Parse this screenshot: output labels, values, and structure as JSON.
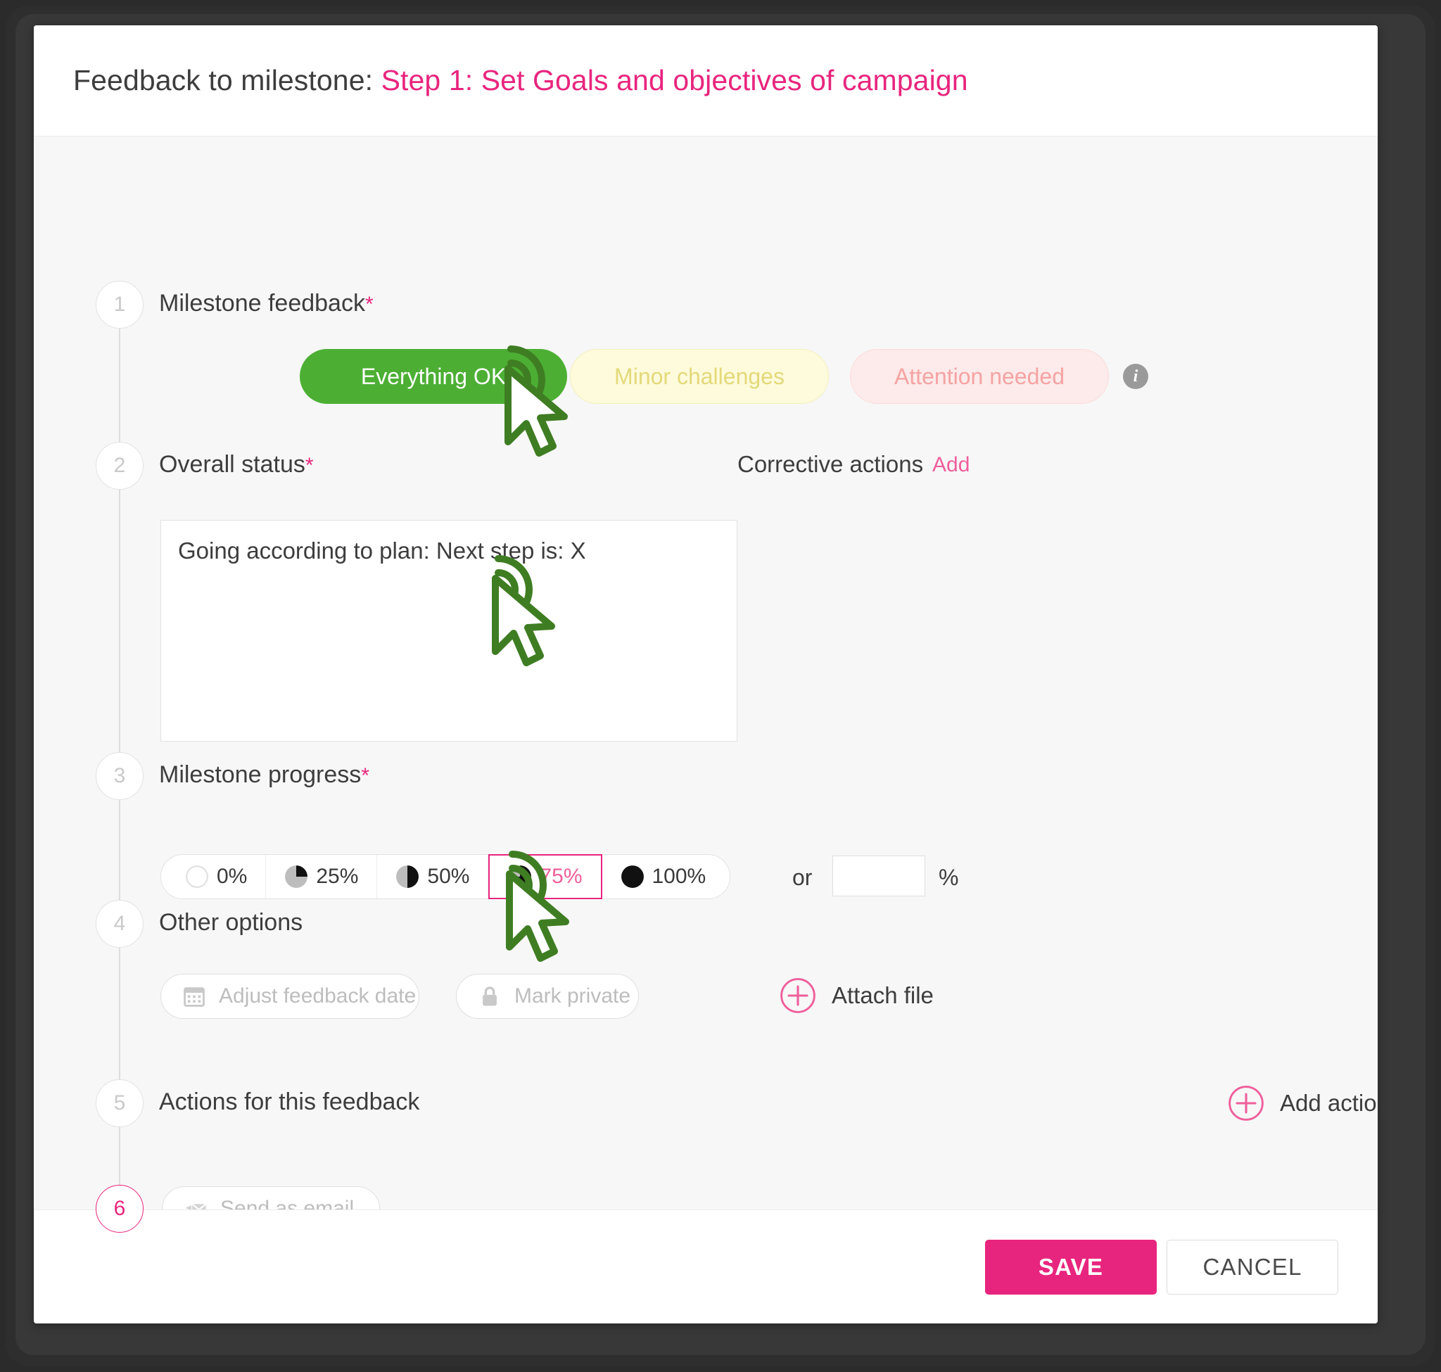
{
  "dialog": {
    "title_prefix": "Feedback to milestone:",
    "title_accent": "Step 1: Set Goals and objectives of campaign"
  },
  "steps": [
    {
      "number": "1",
      "label": "Milestone feedback",
      "required": "*"
    },
    {
      "number": "2",
      "label": "Overall status",
      "required": "*"
    },
    {
      "number": "3",
      "label": "Milestone progress",
      "required": "*"
    },
    {
      "number": "4",
      "label": "Other options",
      "required": ""
    },
    {
      "number": "5",
      "label": "Actions for this feedback",
      "required": ""
    },
    {
      "number": "6",
      "label": "",
      "required": ""
    }
  ],
  "feedback_options": {
    "everything_ok": "Everything OK",
    "minor_challenges": "Minor challenges",
    "attention_needed": "Attention needed",
    "info_glyph": "i",
    "selected": "Everything OK"
  },
  "overall_status": {
    "value": "Going according to plan: Next step is: X",
    "placeholder": ""
  },
  "corrective_actions": {
    "label": "Corrective actions",
    "add_label": "Add"
  },
  "milestone_progress": {
    "options": [
      {
        "label": "0%",
        "fill": 0
      },
      {
        "label": "25%",
        "fill": 25
      },
      {
        "label": "50%",
        "fill": 50
      },
      {
        "label": "75%",
        "fill": 75
      },
      {
        "label": "100%",
        "fill": 100
      }
    ],
    "selected": "75%",
    "or_label": "or",
    "custom_value": "",
    "percent_sign": "%"
  },
  "other_options": {
    "adjust_date": "Adjust feedback date",
    "mark_private": "Mark private",
    "attach_file": "Attach file"
  },
  "actions": {
    "add_action": "Add action"
  },
  "send": {
    "send_as_email": "Send as email"
  },
  "footer": {
    "save": "SAVE",
    "cancel": "CANCEL"
  },
  "colors": {
    "accent_pink": "#e8257e",
    "ok_green": "#4caf34",
    "warn_yellow": "#fdfbdb",
    "alert_red": "#fdeaea",
    "cursor_green": "#3f7d23"
  }
}
